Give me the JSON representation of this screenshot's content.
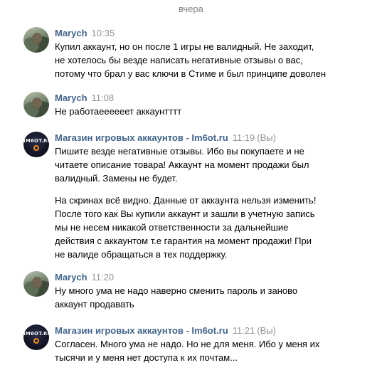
{
  "divider": "вчера",
  "messages": [
    {
      "author": "Marych",
      "time": "10:35",
      "avatar": "user-photo",
      "lines": [
        "Купил аккаунт, но он после 1 игры не валидный. Не заходит,",
        "не хотелось бы везде написать негативные отзывы о вас,",
        "потому что брал у вас ключи в Стиме и был принципе доволен"
      ]
    },
    {
      "author": "Marych",
      "time": "11:08",
      "avatar": "user-photo",
      "lines": [
        "Не работаеееееет аккаунтттт"
      ]
    },
    {
      "author": "Магазин игровых аккаунтов - Im6ot.ru",
      "time": "11:19",
      "you_label": "(Вы)",
      "avatar": "shop-logo",
      "logo_text": "IM6OT.RU",
      "paragraphs": [
        [
          "Пишите везде негативные отзывы. Ибо вы покупаете и не",
          "читаете описание товара! Аккаунт на момент продажи был",
          "валидный. Замены не будет."
        ],
        [
          "На скринах всё видно. Данные от аккаунта нельзя изменить!",
          "После того как Вы купили аккаунт и зашли в учетную запись",
          "мы не несем никакой ответственности за дальнейшие",
          "действия с аккаунтом т.е гарантия на момент продажи! При",
          "не валиде обращаться в тех поддержку."
        ]
      ]
    },
    {
      "author": "Marych",
      "time": "11:20",
      "avatar": "user-photo",
      "lines": [
        "Ну много ума не надо наверно сменить пароль и заново",
        "аккаунт продавать"
      ]
    },
    {
      "author": "Магазин игровых аккаунтов - Im6ot.ru",
      "time": "11:21",
      "you_label": "(Вы)",
      "avatar": "shop-logo",
      "logo_text": "IM6OT.RU",
      "lines": [
        "Согласен. Много ума не надо. Но не для меня. Ибо у меня их",
        "тысячи и у меня нет доступа к их почтам..."
      ]
    }
  ]
}
